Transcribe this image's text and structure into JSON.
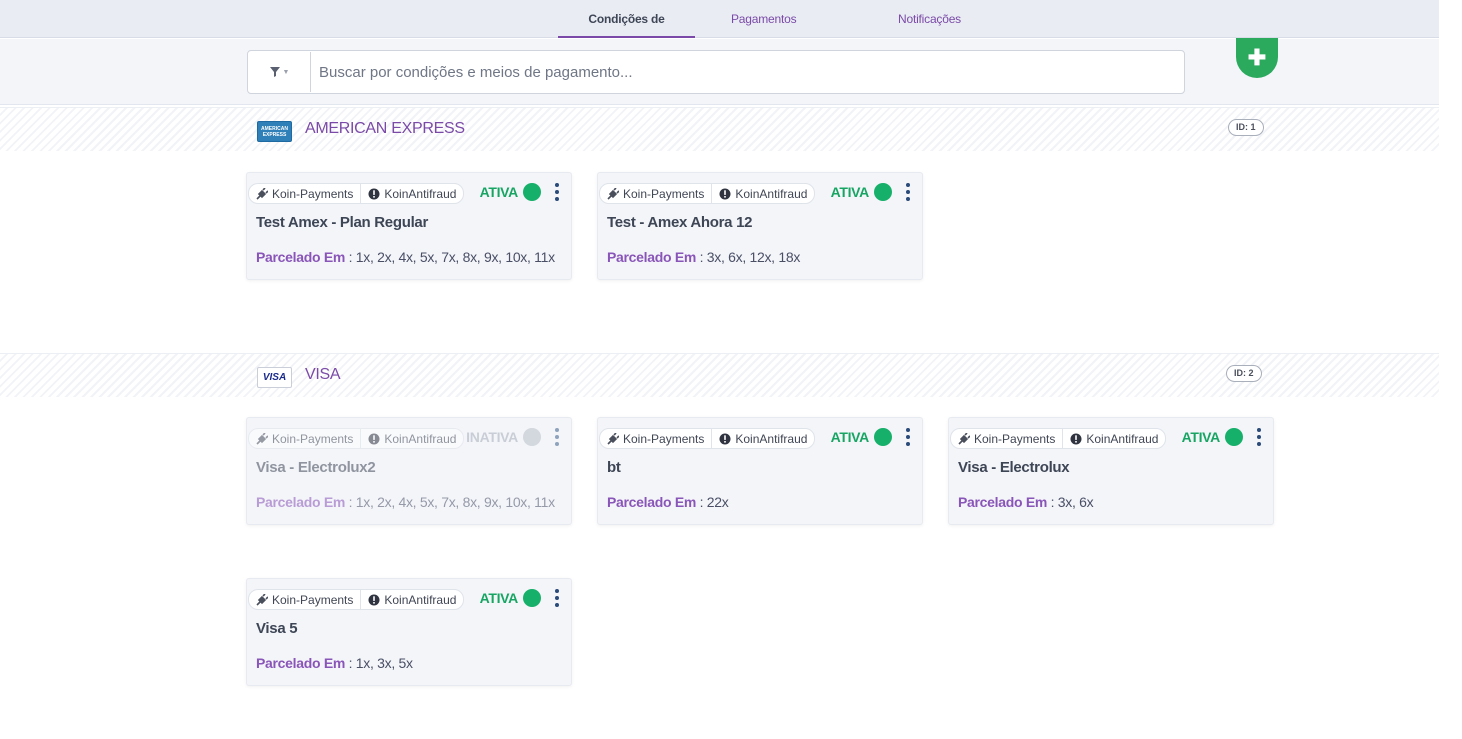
{
  "tabs": [
    {
      "label": "Condições de pagamento",
      "active": true
    },
    {
      "label": "Pagamentos customizados",
      "active": false
    },
    {
      "label": "Notificações",
      "active": false
    }
  ],
  "search": {
    "placeholder": "Buscar por condições e meios de pagamento...",
    "value": ""
  },
  "icons": {
    "filter": "funnel-icon",
    "add": "plus-icon",
    "gateway": "plug-icon",
    "antifraud": "info-circle-icon",
    "menu": "vertical-dots-icon"
  },
  "colors": {
    "accent": "#7b4aa8",
    "active": "#17b06a",
    "add_button": "#2baa5e"
  },
  "groups": [
    {
      "name": "AMERICAN EXPRESS",
      "logo_text": "AMERICAN EXPRESS",
      "id_label": "ID: 1",
      "cards": [
        {
          "gateway": "Koin-Payments",
          "antifraud": "KoinAntifraud",
          "status": "ATIVA",
          "active": true,
          "title": "Test Amex - Plan Regular",
          "inst_label": "Parcelado Em",
          "inst_values": " : 1x, 2x, 4x, 5x, 7x, 8x, 9x, 10x, 11x"
        },
        {
          "gateway": "Koin-Payments",
          "antifraud": "KoinAntifraud",
          "status": "ATIVA",
          "active": true,
          "title": "Test - Amex Ahora 12",
          "inst_label": "Parcelado Em",
          "inst_values": " : 3x, 6x, 12x, 18x"
        }
      ]
    },
    {
      "name": "VISA",
      "logo_text": "VISA",
      "id_label": "ID: 2",
      "cards": [
        {
          "gateway": "Koin-Payments",
          "antifraud": "KoinAntifraud",
          "status": "INATIVA",
          "active": false,
          "title": "Visa - Electrolux2",
          "inst_label": "Parcelado Em",
          "inst_values": " : 1x, 2x, 4x, 5x, 7x, 8x, 9x, 10x, 11x"
        },
        {
          "gateway": "Koin-Payments",
          "antifraud": "KoinAntifraud",
          "status": "ATIVA",
          "active": true,
          "title": "bt",
          "inst_label": "Parcelado Em",
          "inst_values": " : 22x"
        },
        {
          "gateway": "Koin-Payments",
          "antifraud": "KoinAntifraud",
          "status": "ATIVA",
          "active": true,
          "title": "Visa - Electrolux",
          "inst_label": "Parcelado Em",
          "inst_values": " : 3x, 6x"
        },
        {
          "gateway": "Koin-Payments",
          "antifraud": "KoinAntifraud",
          "status": "ATIVA",
          "active": true,
          "title": "Visa 5",
          "inst_label": "Parcelado Em",
          "inst_values": " : 1x, 3x, 5x"
        }
      ]
    }
  ]
}
